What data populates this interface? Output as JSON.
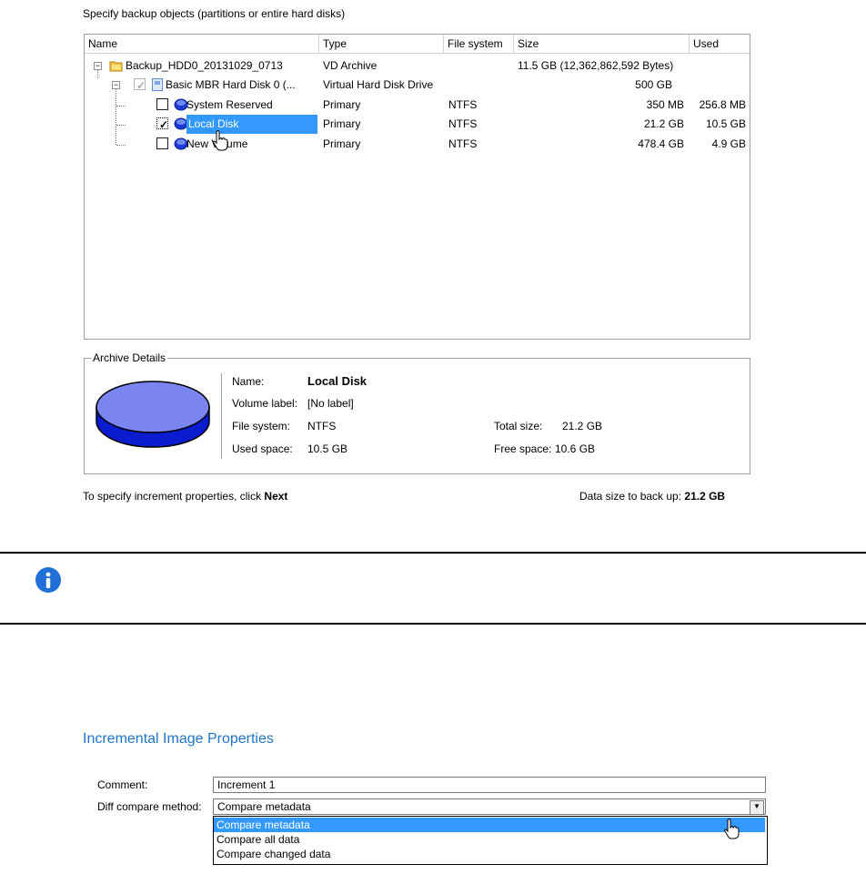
{
  "instruction": "Specify backup objects (partitions or entire hard disks)",
  "columns": {
    "name": "Name",
    "type": "Type",
    "fs": "File system",
    "size": "Size",
    "used": "Used"
  },
  "rows": [
    {
      "name": "Backup_HDD0_20131029_0713",
      "type": "VD Archive",
      "fs": "",
      "size": "11.5 GB (12,362,862,592 Bytes)",
      "used": ""
    },
    {
      "name": "Basic MBR Hard Disk 0 (...",
      "type": "Virtual Hard Disk Drive",
      "fs": "",
      "size": "500 GB",
      "used": ""
    },
    {
      "name": "System Reserved",
      "type": "Primary",
      "fs": "NTFS",
      "size": "350 MB",
      "used": "256.8 MB"
    },
    {
      "name": "Local Disk",
      "type": "Primary",
      "fs": "NTFS",
      "size": "21.2 GB",
      "used": "10.5 GB"
    },
    {
      "name": "New Volume",
      "type": "Primary",
      "fs": "NTFS",
      "size": "478.4 GB",
      "used": "4.9 GB"
    }
  ],
  "details": {
    "title": "Archive Details",
    "name_label": "Name:",
    "name_value": "Local Disk",
    "volume_label": "Volume label:",
    "volume_value": "[No label]",
    "fs_label": "File system:",
    "fs_value": "NTFS",
    "used_label": "Used space:",
    "used_value": "10.5 GB",
    "total_label": "Total size:",
    "total_value": "21.2 GB",
    "free_label": "Free space:",
    "free_value": "10.6 GB"
  },
  "footer": {
    "hint_prefix": "To specify increment properties, click ",
    "hint_bold": "Next",
    "data_size_prefix": "Data size to back up: ",
    "data_size_value": "21.2 GB"
  },
  "info_icon": "info-icon",
  "props": {
    "title": "Incremental Image Properties",
    "comment_label": "Comment:",
    "comment_value": "Increment 1",
    "diff_label": "Diff compare method:",
    "diff_value": "Compare metadata",
    "options": [
      "Compare metadata",
      "Compare all data",
      "Compare changed data"
    ]
  },
  "colors": {
    "accent": "#1d75c3",
    "selection": "#3399ff",
    "info": "#1f6fd6"
  }
}
